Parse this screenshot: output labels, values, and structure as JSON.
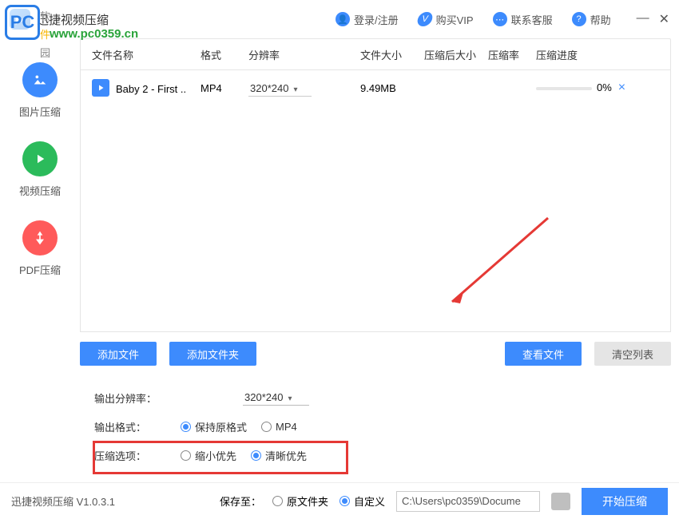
{
  "titlebar": {
    "app_title": "迅捷视频压缩",
    "login": "登录/注册",
    "vip": "购买VIP",
    "service": "联系客服",
    "help": "帮助"
  },
  "watermark": {
    "badge": "PC",
    "site": "软件园",
    "url": "www.pc0359.cn"
  },
  "sidebar": {
    "items": [
      {
        "label": "图片压缩"
      },
      {
        "label": "视频压缩"
      },
      {
        "label": "PDF压缩"
      }
    ]
  },
  "table": {
    "headers": {
      "name": "文件名称",
      "fmt": "格式",
      "res": "分辨率",
      "size": "文件大小",
      "after": "压缩后大小",
      "rate": "压缩率",
      "prog": "压缩进度"
    },
    "row": {
      "name": "Baby 2 - First ..",
      "fmt": "MP4",
      "res": "320*240",
      "size": "9.49MB",
      "prog": "0%"
    }
  },
  "buttons": {
    "add_file": "添加文件",
    "add_folder": "添加文件夹",
    "view": "查看文件",
    "clear": "清空列表"
  },
  "options": {
    "res_label": "输出分辨率：",
    "res_value": "320*240",
    "fmt_label": "输出格式：",
    "fmt_keep": "保持原格式",
    "fmt_mp4": "MP4",
    "comp_label": "压缩选项：",
    "comp_small": "缩小优先",
    "comp_clear": "清晰优先"
  },
  "footer": {
    "version": "迅捷视频压缩 V1.0.3.1",
    "save_label": "保存至：",
    "save_orig": "原文件夹",
    "save_custom": "自定义",
    "path": "C:\\Users\\pc0359\\Docume",
    "start": "开始压缩"
  }
}
